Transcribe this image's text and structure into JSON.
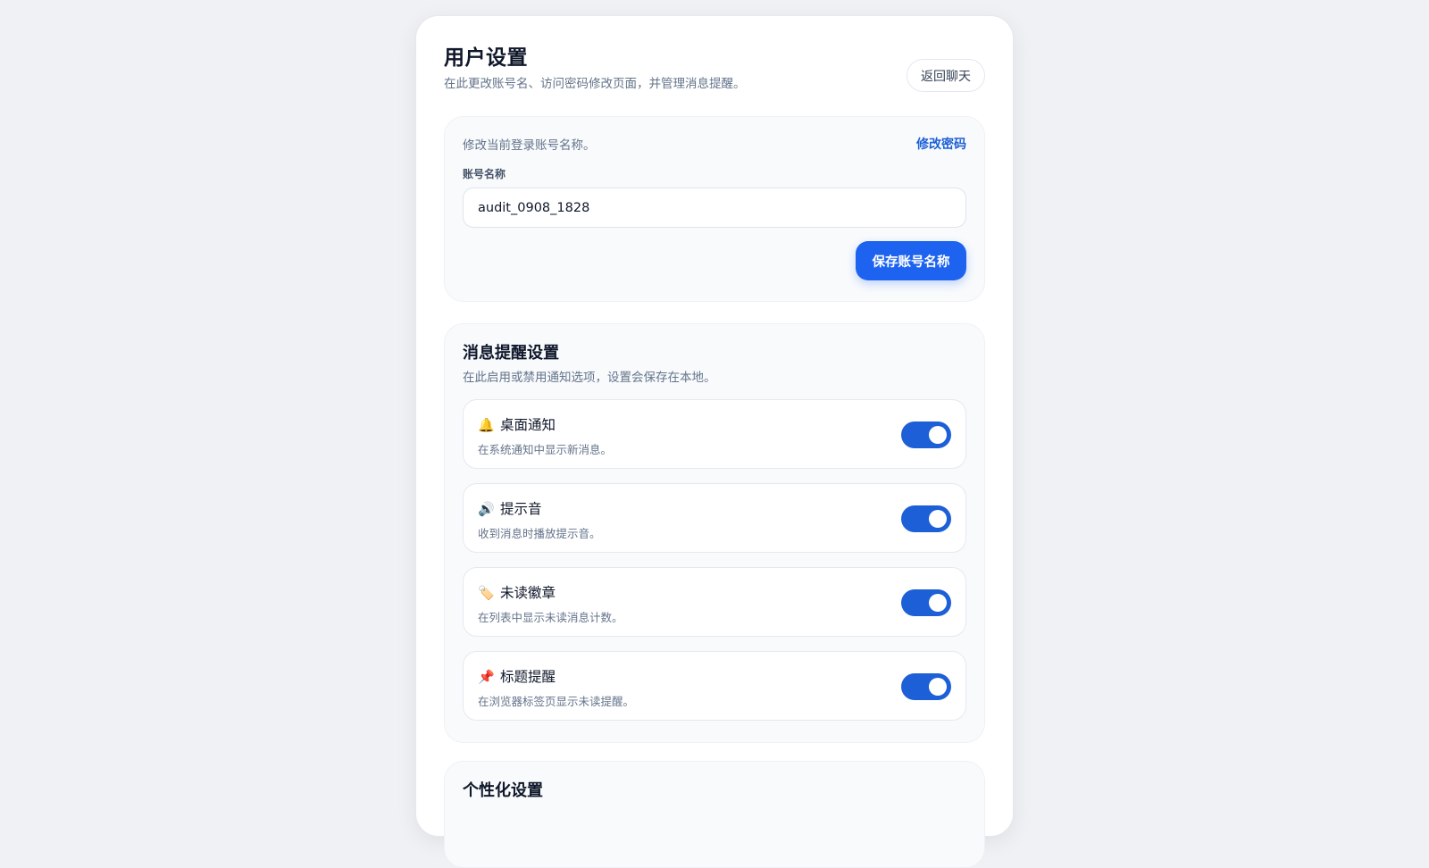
{
  "header": {
    "title": "用户设置",
    "subtitle": "在此更改账号名、访问密码修改页面，并管理消息提醒。",
    "back_label": "返回聊天"
  },
  "account": {
    "hint": "修改当前登录账号名称。",
    "change_password_label": "修改密码",
    "field_label": "账号名称",
    "account_name_value": "audit_0908_1828",
    "save_label": "保存账号名称"
  },
  "notifications": {
    "title": "消息提醒设置",
    "description": "在此启用或禁用通知选项，设置会保存在本地。",
    "items": [
      {
        "emoji": "🔔",
        "icon": "bell-icon",
        "label": "桌面通知",
        "description": "在系统通知中显示新消息。",
        "enabled": true
      },
      {
        "emoji": "🔊",
        "icon": "speaker-icon",
        "label": "提示音",
        "description": "收到消息时播放提示音。",
        "enabled": true
      },
      {
        "emoji": "🏷️",
        "icon": "tag-icon",
        "label": "未读徽章",
        "description": "在列表中显示未读消息计数。",
        "enabled": true
      },
      {
        "emoji": "📌",
        "icon": "pushpin-icon",
        "label": "标题提醒",
        "description": "在浏览器标签页显示未读提醒。",
        "enabled": true
      }
    ]
  },
  "personalization": {
    "title": "个性化设置"
  },
  "colors": {
    "accent": "#1d63f0",
    "toggle_on": "#1d5fd6",
    "link": "#1d5fd6"
  }
}
